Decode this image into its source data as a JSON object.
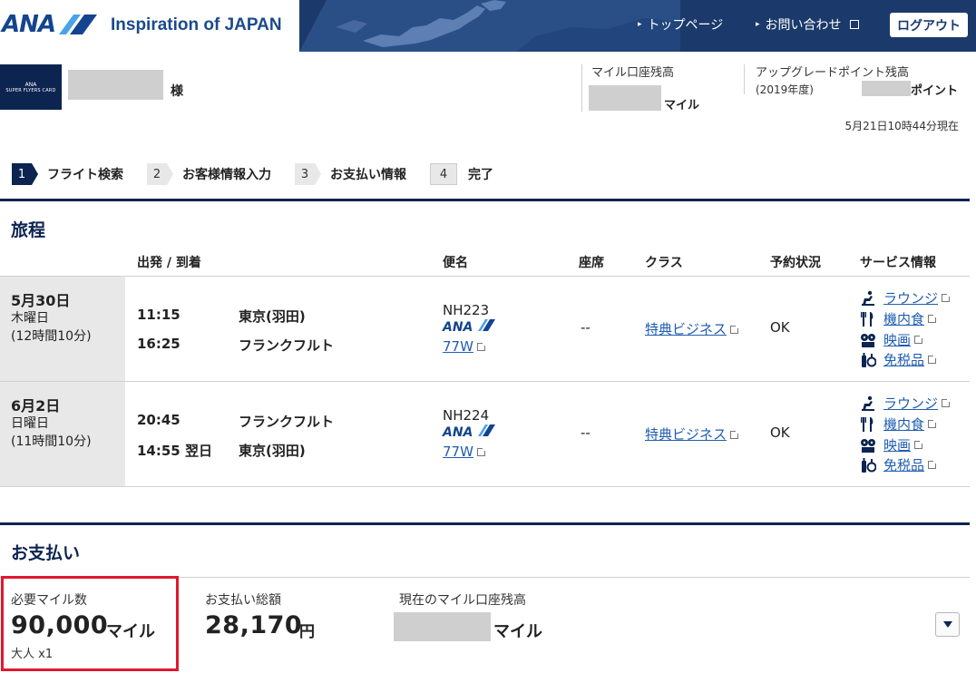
{
  "header": {
    "logo": "ANA",
    "tagline": "Inspiration of JAPAN",
    "nav": [
      "トップページ",
      "お問い合わせ"
    ],
    "logout": "ログアウト"
  },
  "member": {
    "card_lines": [
      "ANA",
      "SUPER FLYERS CARD"
    ],
    "honorific": "様",
    "miles_label": "マイル口座残高",
    "miles_unit": "マイル",
    "upgrade_label": "アップグレードポイント残高",
    "upgrade_year": "(2019年度)",
    "upgrade_unit": "ポイント",
    "timestamp": "5月21日10時44分現在"
  },
  "steps": [
    {
      "num": "1",
      "label": "フライト検索",
      "active": true
    },
    {
      "num": "2",
      "label": "お客様情報入力",
      "active": false
    },
    {
      "num": "3",
      "label": "お支払い情報",
      "active": false
    },
    {
      "num": "4",
      "label": "完了",
      "active": false
    }
  ],
  "itinerary": {
    "title": "旅程",
    "columns": {
      "dep_arr": "出発 / 到着",
      "flight": "便名",
      "seat": "座席",
      "class": "クラス",
      "status": "予約状況",
      "service": "サービス情報"
    },
    "segments": [
      {
        "date": "5月30日",
        "weekday": "木曜日",
        "duration": "(12時間10分)",
        "dep_time": "11:15",
        "dep_place": "東京(羽田)",
        "arr_time": "16:25",
        "arr_place": "フランクフルト",
        "flight_no": "NH223",
        "airline": "ANA",
        "aircraft": "77W",
        "seat": "--",
        "class": "特典ビジネス",
        "status": "OK",
        "services": [
          "ラウンジ",
          "機内食",
          "映画",
          "免税品"
        ]
      },
      {
        "date": "6月2日",
        "weekday": "日曜日",
        "duration": "(11時間10分)",
        "dep_time": "20:45",
        "dep_place": "フランクフルト",
        "arr_time": "14:55 翌日",
        "arr_place": "東京(羽田)",
        "flight_no": "NH224",
        "airline": "ANA",
        "aircraft": "77W",
        "seat": "--",
        "class": "特典ビジネス",
        "status": "OK",
        "services": [
          "ラウンジ",
          "機内食",
          "映画",
          "免税品"
        ]
      }
    ]
  },
  "payment": {
    "title": "お支払い",
    "required_miles_label": "必要マイル数",
    "required_miles": "90,000",
    "required_miles_unit": "マイル",
    "passengers": "大人 x1",
    "total_label": "お支払い総額",
    "total": "28,170",
    "total_unit": "円",
    "balance_label": "現在のマイル口座残高",
    "balance_unit": "マイル"
  },
  "colors": {
    "navy": "#0c2450",
    "brand_blue": "#13448f",
    "link": "#1f5db0",
    "highlight": "#e0182d"
  }
}
